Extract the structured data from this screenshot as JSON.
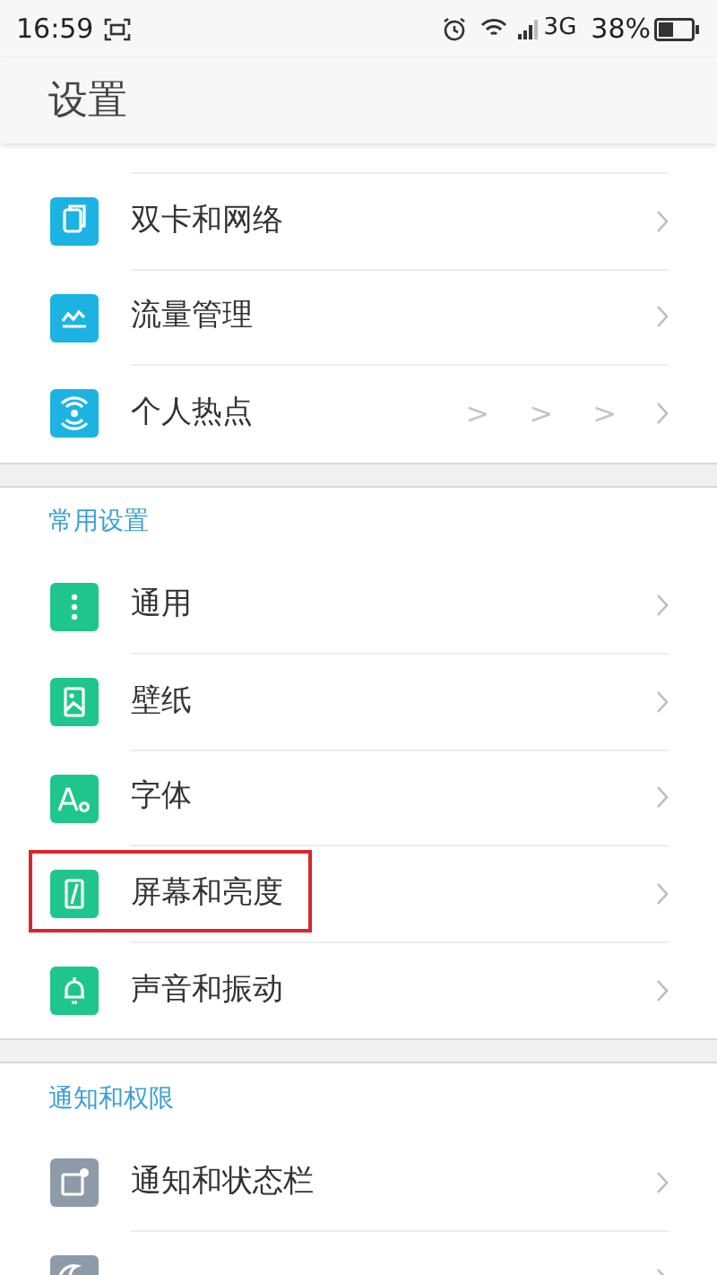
{
  "status_bar": {
    "time": "16:59",
    "network": "3G",
    "battery": "38%"
  },
  "header": {
    "title": "设置"
  },
  "sections": [
    {
      "items": [
        {
          "kind": "sim",
          "label": "双卡和网络",
          "color": "#1cb3e3",
          "highlighted": false
        },
        {
          "kind": "chart",
          "label": "流量管理",
          "color": "#1cb3e3",
          "highlighted": false
        },
        {
          "kind": "hotspot",
          "label": "个人热点",
          "color": "#1cb3e3",
          "highlighted": false,
          "stray_marks": [
            ">",
            ">",
            ">"
          ]
        }
      ]
    },
    {
      "header": "常用设置",
      "items": [
        {
          "kind": "dots",
          "label": "通用",
          "color": "#1fc68b",
          "highlighted": false
        },
        {
          "kind": "wallpaper",
          "label": "壁纸",
          "color": "#1fc68b",
          "highlighted": false
        },
        {
          "kind": "font",
          "label": "字体",
          "color": "#1fc68b",
          "highlighted": false
        },
        {
          "kind": "screen",
          "label": "屏幕和亮度",
          "color": "#1fc68b",
          "highlighted": true
        },
        {
          "kind": "bell",
          "label": "声音和振动",
          "color": "#1fc68b",
          "highlighted": false
        }
      ]
    },
    {
      "header": "通知和权限",
      "items": [
        {
          "kind": "notice",
          "label": "通知和状态栏",
          "color": "#8d9ba8",
          "highlighted": false
        },
        {
          "kind": "moon",
          "color": "#8d9ba8"
        }
      ]
    }
  ]
}
